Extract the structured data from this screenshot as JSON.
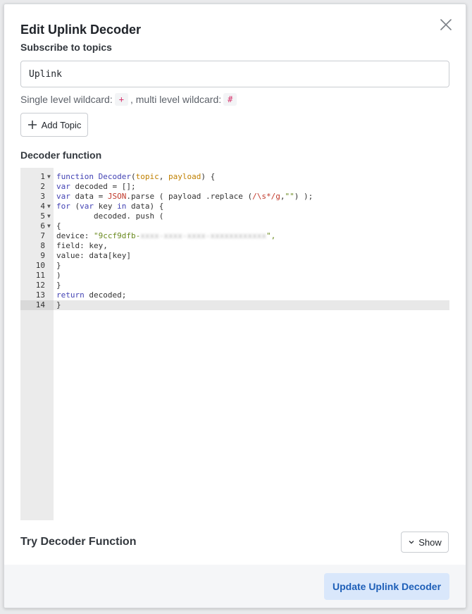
{
  "dialog": {
    "title": "Edit Uplink Decoder",
    "subscribe_label": "Subscribe to topics",
    "topic_value": "Uplink",
    "wildcard_text_1": "Single level wildcard:",
    "wildcard_single": "+",
    "wildcard_text_2": ", multi level wildcard:",
    "wildcard_multi": "#",
    "add_topic_label": "Add Topic",
    "decoder_label": "Decoder function",
    "try_label": "Try Decoder Function",
    "show_label": "Show",
    "update_label": "Update Uplink Decoder"
  },
  "code_lines": [
    "function Decoder(topic, payload) {",
    "var decoded = [];",
    "var data = JSON.parse ( payload .replace (/\\s*/g,\"\") );",
    "for (var key in data) {",
    "        decoded. push (",
    "{",
    "device: \"9ccf9dfb-\",",
    "field: key,",
    "value: data[key]",
    "}",
    ")",
    "}",
    "return decoded;",
    "}"
  ],
  "line_numbers": [
    "1",
    "2",
    "3",
    "4",
    "5",
    "6",
    "7",
    "8",
    "9",
    "10",
    "11",
    "12",
    "13",
    "14"
  ],
  "code_tokens": {
    "l1_kw": "function",
    "l1_fn": " Decoder",
    "l1_p1": "(",
    "l1_topic": "topic",
    "l1_comma": ", ",
    "l1_payload": "payload",
    "l1_end": ") {",
    "l2_kw": "var",
    "l2_rest": " decoded = [];",
    "l3_kw": "var",
    "l3_mid": " data = ",
    "l3_json": "JSON",
    "l3_rest1": ".parse ( payload .replace (",
    "l3_re": "/\\s*/g",
    "l3_comma": ",",
    "l3_str": "\"\"",
    "l3_end": ") );",
    "l4_kw1": "for",
    "l4_p": " (",
    "l4_kw2": "var",
    "l4_mid": " key ",
    "l4_kw3": "in",
    "l4_end": " data) {",
    "l5": "        decoded. push (",
    "l6": "{",
    "l7_key": "device: ",
    "l7_str": "\"9ccf9dfb-",
    "l7_blur": "xxxx-xxxx-xxxx-xxxxxxxxxxxx",
    "l7_end": "\",",
    "l8": "field: key,",
    "l9": "value: data[key]",
    "l10": "}",
    "l11": ")",
    "l12": "}",
    "l13_kw": "return",
    "l13_rest": " decoded;",
    "l14": "}"
  },
  "colors": {
    "primary": "#1e5fb8",
    "primary_bg": "#d9e7fb",
    "chip_text": "#d6336c"
  }
}
